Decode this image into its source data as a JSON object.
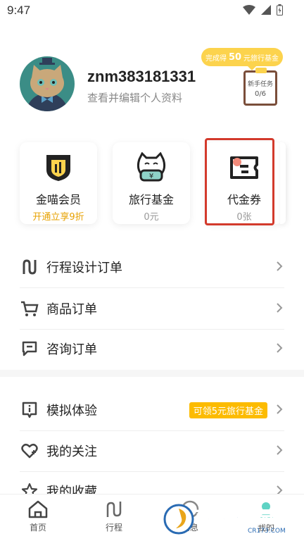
{
  "status_bar": {
    "time": "9:47"
  },
  "profile": {
    "username": "znm383181331",
    "subtitle": "查看并编辑个人资料"
  },
  "task": {
    "bubble_prefix": "完成得",
    "bubble_amount": "50",
    "bubble_suffix": "元旅行基金",
    "board_title": "新手任务",
    "board_progress": "0/6"
  },
  "cards": [
    {
      "title": "金喵会员",
      "sub": "开通立享9折",
      "icon": "gold-shield-icon"
    },
    {
      "title": "旅行基金",
      "sub": "0元",
      "icon": "money-cat-icon"
    },
    {
      "title": "代金券",
      "sub": "0张",
      "icon": "coupon-icon"
    }
  ],
  "menu_group1": [
    {
      "label": "行程设计订单",
      "icon": "itinerary-icon"
    },
    {
      "label": "商品订单",
      "icon": "cart-icon"
    },
    {
      "label": "咨询订单",
      "icon": "chat-icon"
    }
  ],
  "menu_group2": [
    {
      "label": "模拟体验",
      "icon": "info-icon",
      "tag": "可领5元旅行基金"
    },
    {
      "label": "我的关注",
      "icon": "heart-icon"
    },
    {
      "label": "我的收藏",
      "icon": "star-icon"
    }
  ],
  "bottom_nav": [
    {
      "label": "首页",
      "icon": "home-icon"
    },
    {
      "label": "行程",
      "icon": "trip-icon"
    },
    {
      "label": "消息",
      "icon": "message-icon"
    },
    {
      "label": "我的",
      "icon": "profile-icon"
    }
  ],
  "watermark": {
    "text": "西西软件园",
    "url_text": "CR173.COM"
  },
  "colors": {
    "accent_yellow": "#fcd34d",
    "tag_orange": "#fcbb00",
    "highlight_red": "#d33a2c",
    "icon_dark": "#222222"
  }
}
